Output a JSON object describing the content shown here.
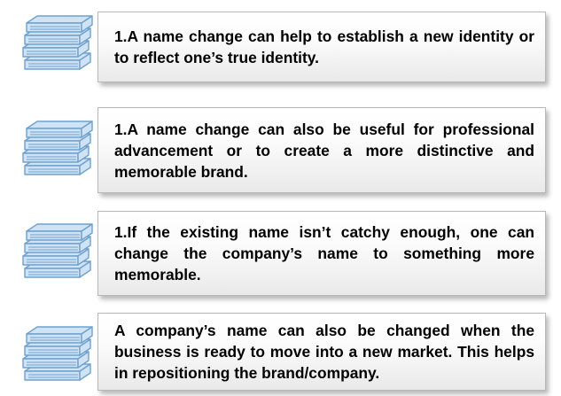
{
  "items": [
    {
      "icon": "book-stack-icon",
      "text": "1.A name change can help to establish a new identity or to reflect one’s true identity."
    },
    {
      "icon": "book-stack-icon",
      "text": "1.A name change can also be useful for professional advancement or to create a more distinctive and memorable brand."
    },
    {
      "icon": "book-stack-icon",
      "text": "1.If the existing name isn’t catchy enough, one can change the company’s name to something more memorable."
    },
    {
      "icon": "book-stack-icon",
      "text": "A company’s name can also be changed when the business is ready to move into a new market. This helps in repositioning the brand/company."
    }
  ],
  "colors": {
    "icon_fill": "#cfe3f4",
    "icon_stroke": "#6fa1cf",
    "card_border": "#b8b8b8",
    "text": "#000000"
  }
}
